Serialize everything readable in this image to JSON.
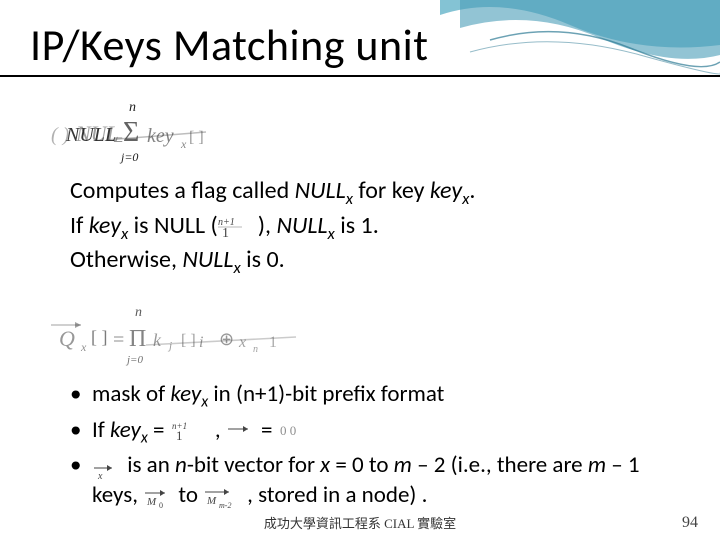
{
  "title": "IP/Keys Matching unit",
  "body1": {
    "line1_a": "Computes a flag called ",
    "line1_b": " for key ",
    "line1_c": ".",
    "line2_a": "If ",
    "line2_b": " is NULL (",
    "line2_c": "), ",
    "line2_d": " is 1.",
    "line3_a": "Otherwise, ",
    "line3_b": " is 0."
  },
  "body2": {
    "b1_a": "mask of ",
    "b1_b": " in (n+1)-bit prefix format",
    "b2_a": "If ",
    "b2_b": " = ",
    "b2_c": " , ",
    "b2_d": " = ",
    "b3_a": " is an ",
    "b3_b": "-bit vector for ",
    "b3_c": " = 0 to ",
    "b3_d": " – 2 (",
    "b3_e": "i.e.",
    "b3_f": ", there are ",
    "b3_g": " – 1 keys, ",
    "b3_h": " to ",
    "b3_i": ", stored in a node) ."
  },
  "math": {
    "NULL": "NULL",
    "key": "key",
    "x": "x",
    "n": "n",
    "m": "m"
  },
  "footer": "成功大學資訊工程系    CIAL 實驗室",
  "page": "94"
}
